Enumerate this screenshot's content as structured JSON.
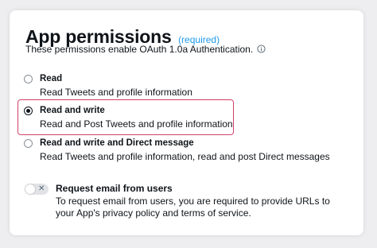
{
  "panel": {
    "title": "App permissions",
    "required_label": "(required)",
    "subtitle": "These permissions enable OAuth 1.0a Authentication.",
    "info_icon": "info-circle-icon"
  },
  "options": [
    {
      "label": "Read",
      "description": "Read Tweets and profile information",
      "selected": false
    },
    {
      "label": "Read and write",
      "description": "Read and Post Tweets and profile information",
      "selected": true
    },
    {
      "label": "Read and write and Direct message",
      "description": "Read Tweets and profile information, read and post Direct messages",
      "selected": false
    }
  ],
  "email": {
    "label": "Request email from users",
    "description": "To request email from users, you are required to provide URLs to your App's privacy policy and terms of service.",
    "toggle_on": false,
    "toggle_glyph": "✕"
  },
  "colors": {
    "accent": "#1d9bf0",
    "highlight": "#d0416a",
    "text": "#0f1419"
  }
}
